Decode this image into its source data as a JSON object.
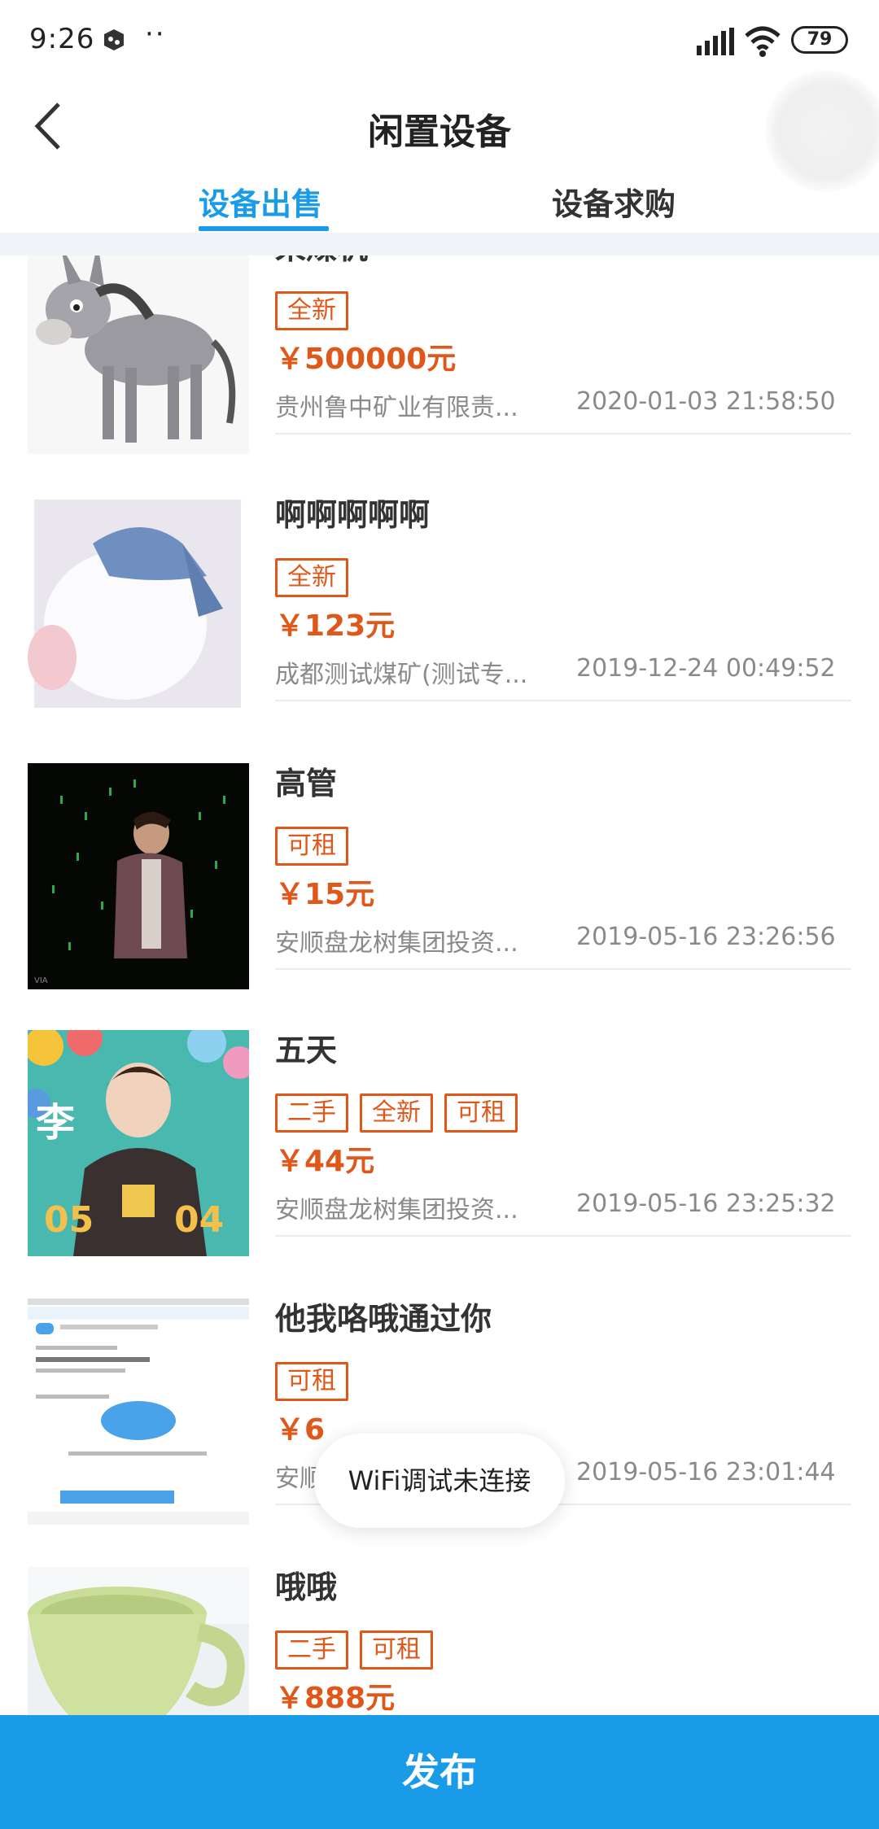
{
  "status_bar": {
    "time": "9:26",
    "dots": "··",
    "battery": "79"
  },
  "header": {
    "title": "闲置设备"
  },
  "tabs": [
    {
      "label": "设备出售",
      "active": true
    },
    {
      "label": "设备求购",
      "active": false
    }
  ],
  "items": [
    {
      "name": "采煤机",
      "tags": [
        "全新"
      ],
      "price": "￥500000元",
      "company": "贵州鲁中矿业有限责...",
      "date": "2020-01-03 21:58:50",
      "image": "donkey-cartoon"
    },
    {
      "name": "啊啊啊啊啊",
      "tags": [
        "全新"
      ],
      "price": "￥123元",
      "company": "成都测试煤矿(测试专...",
      "date": "2019-12-24 00:49:52",
      "image": "white-cat-with-hat"
    },
    {
      "name": "高管",
      "tags": [
        "可租"
      ],
      "price": "￥15元",
      "company": "安顺盘龙树集团投资...",
      "date": "2019-05-16 23:26:56",
      "image": "singer-on-stage"
    },
    {
      "name": "五天",
      "tags": [
        "二手",
        "全新",
        "可租"
      ],
      "price": "￥44元",
      "company": "安顺盘龙树集团投资...",
      "date": "2019-05-16 23:25:32",
      "image": "birthday-poster"
    },
    {
      "name": "他我咯哦通过你",
      "tags": [
        "可租"
      ],
      "price": "￥6",
      "company": "安顺",
      "date": "2019-05-16 23:01:44",
      "image": "app-screenshot"
    },
    {
      "name": "哦哦",
      "tags": [
        "二手",
        "可租"
      ],
      "price": "￥888元",
      "company": "",
      "date": "",
      "image": "green-cup"
    }
  ],
  "toast": {
    "text": "WiFi调试未连接"
  },
  "publish_button": {
    "label": "发布"
  },
  "colors": {
    "accent": "#1a9be8",
    "price": "#e0571a",
    "muted": "#8a8a8a"
  }
}
